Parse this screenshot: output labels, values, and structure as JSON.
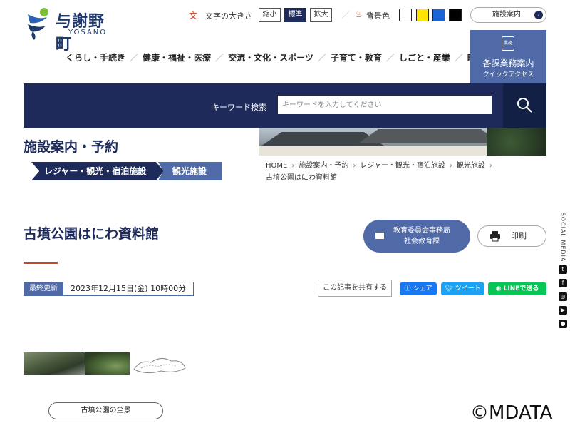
{
  "header": {
    "logo_name": "与謝野町",
    "logo_en": "YOSANO",
    "font_size": {
      "label": "文字の大きさ",
      "icon_glyph": "文",
      "small": "縮小",
      "standard": "標準",
      "large": "拡大",
      "active": "standard"
    },
    "bg_color": {
      "label": "背景色",
      "swatches": [
        "#ffffff",
        "#ffe600",
        "#1a64d8",
        "#000000"
      ]
    },
    "facility_link": "施設案内",
    "quick_access": {
      "title": "各課業務案内",
      "subtitle": "クイックアクセス",
      "icon_text": "業務"
    }
  },
  "nav": {
    "items": [
      "くらし・手続き",
      "健康・福祉・医療",
      "交流・文化・スポーツ",
      "子育て・教育",
      "しごと・産業",
      "町政"
    ]
  },
  "search": {
    "label": "キーワード検索",
    "placeholder": "キーワードを入力してください"
  },
  "section": {
    "title": "施設案内・予約",
    "category": "レジャー・観光・宿泊施設",
    "subcategory": "観光施設"
  },
  "breadcrumb": {
    "items": [
      "HOME",
      "施設案内・予約",
      "レジャー・観光・宿泊施設",
      "観光施設",
      "古墳公園はにわ資料館"
    ]
  },
  "page": {
    "title": "古墳公園はにわ資料館",
    "dept_line1": "教育委員会事務局",
    "dept_line2": "社会教育課",
    "print_label": "印刷",
    "updated_label": "最終更新",
    "updated_value": "2023年12月15日(金) 10時00分",
    "share_label": "この記事を共有する",
    "share_facebook": "シェア",
    "share_twitter": "ツイート",
    "share_line": "LINEで送る",
    "photo_caption": "古墳公園の全景"
  },
  "social": {
    "label": "SOCIAL MEDIA",
    "icons": [
      "twitter-icon",
      "facebook-icon",
      "instagram-icon",
      "youtube-icon",
      "line-icon"
    ]
  },
  "watermark": "©MDATA",
  "colors": {
    "navy": "#1d2a5a",
    "accent_blue": "#4f6aa6",
    "accent_red": "#c8472c"
  }
}
